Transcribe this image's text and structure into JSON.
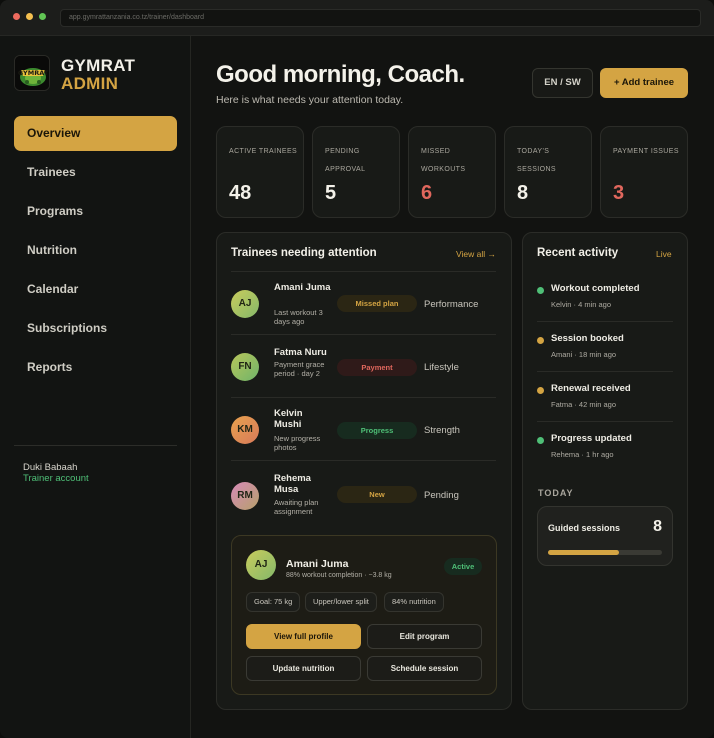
{
  "browser": {
    "url": "app.gymrattanzania.co.tz/trainer/dashboard"
  },
  "brand": {
    "line1": "GYMRAT",
    "line2": "ADMIN",
    "logo_text": "GYMRAT"
  },
  "sidebar": {
    "items": [
      {
        "label": "Overview",
        "active": true
      },
      {
        "label": "Trainees"
      },
      {
        "label": "Programs"
      },
      {
        "label": "Nutrition"
      },
      {
        "label": "Calendar"
      },
      {
        "label": "Subscriptions"
      },
      {
        "label": "Reports"
      }
    ],
    "user": {
      "name": "Duki Babaah",
      "role": "Trainer account"
    }
  },
  "header": {
    "greeting": "Good morning, Coach.",
    "subtitle": "Here is what needs your attention today.",
    "lang_button": "EN / SW",
    "add_button": "+ Add trainee"
  },
  "stats": [
    {
      "label": "ACTIVE TRAINEES",
      "value": "48",
      "alert": false
    },
    {
      "label": "PENDING APPROVAL",
      "value": "5",
      "alert": false
    },
    {
      "label": "MISSED WORKOUTS",
      "value": "6",
      "alert": true
    },
    {
      "label": "TODAY'S SESSIONS",
      "value": "8",
      "alert": false
    },
    {
      "label": "PAYMENT ISSUES",
      "value": "3",
      "alert": true
    }
  ],
  "attention": {
    "title": "Trainees needing attention",
    "view_all": "View all →",
    "rows": [
      {
        "initials": "AJ",
        "name": "Amani Juma",
        "sub": "Last workout 3 days ago",
        "tag": "Missed plan",
        "program": "Performance"
      },
      {
        "initials": "FN",
        "name": "Fatma Nuru",
        "sub": "Payment grace period · day 2",
        "tag": "Payment",
        "program": "Lifestyle"
      },
      {
        "initials": "KM",
        "name": "Kelvin Mushi",
        "sub": "New progress photos",
        "tag": "Progress",
        "program": "Strength"
      },
      {
        "initials": "RM",
        "name": "Rehema Musa",
        "sub": "Awaiting plan assignment",
        "tag": "New",
        "program": "Pending"
      }
    ]
  },
  "profile": {
    "initials": "AJ",
    "name": "Amani Juma",
    "sub": "88% workout completion · −3.8 kg",
    "status": "Active",
    "chips": [
      "Goal: 75 kg",
      "Upper/lower split",
      "84% nutrition"
    ],
    "buttons": [
      "View full profile",
      "Edit program",
      "Update nutrition",
      "Schedule session"
    ]
  },
  "activity": {
    "title": "Recent activity",
    "live": "Live",
    "items": [
      {
        "title": "Workout completed",
        "sub": "Kelvin · 4 min ago",
        "color": "#4fbf77"
      },
      {
        "title": "Session booked",
        "sub": "Amani · 18 min ago",
        "color": "#d4a443"
      },
      {
        "title": "Renewal received",
        "sub": "Fatma · 42 min ago",
        "color": "#d4a443"
      },
      {
        "title": "Progress updated",
        "sub": "Rehema · 1 hr ago",
        "color": "#4fbf77"
      }
    ],
    "today_label": "TODAY",
    "today_card": {
      "label": "Guided sessions",
      "value": "8",
      "progress": 0.62
    }
  },
  "colors": {
    "accent": "#d4a443",
    "success": "#4fbf77",
    "danger": "#e0675d"
  }
}
